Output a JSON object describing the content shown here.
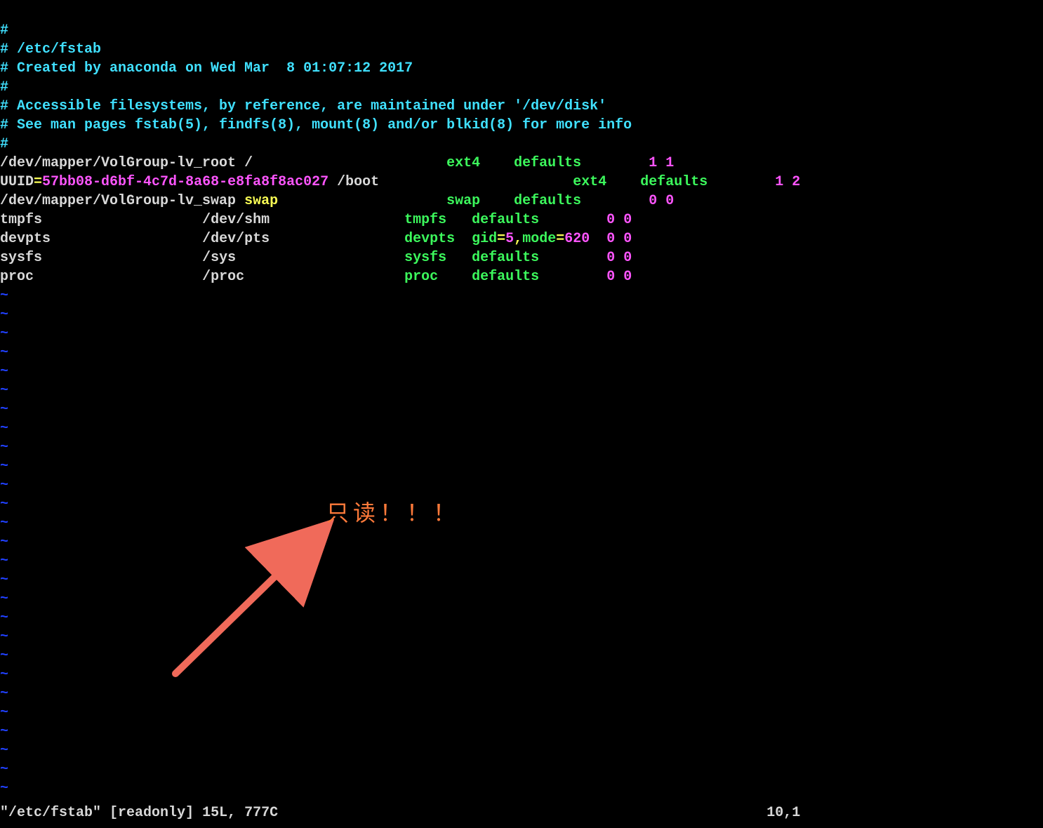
{
  "comments": {
    "l1": "#",
    "l2": "# /etc/fstab",
    "l3": "# Created by anaconda on Wed Mar  8 01:07:12 2017",
    "l4": "#",
    "l5": "# Accessible filesystems, by reference, are maintained under '/dev/disk'",
    "l6": "# See man pages fstab(5), findfs(8), mount(8) and/or blkid(8) for more info",
    "l7": "#"
  },
  "rows": {
    "root": {
      "device": "/dev/mapper/VolGroup-lv_root",
      "mount": "/",
      "type": "ext4",
      "opts": "defaults",
      "dump": "1",
      "pass": "1"
    },
    "boot": {
      "uuid_key": "UUID",
      "eq": "=",
      "uuid": "57bb08-d6bf-4c7d-8a68-e8fa8f8ac027",
      "mount": "/boot",
      "type": "ext4",
      "opts": "defaults",
      "dump": "1",
      "pass": "2"
    },
    "swap": {
      "device": "/dev/mapper/VolGroup-lv_swap",
      "mount": "swap",
      "type": "swap",
      "opts": "defaults",
      "dump": "0",
      "pass": "0"
    },
    "tmpfs": {
      "device": "tmpfs",
      "mount": "/dev/shm",
      "type": "tmpfs",
      "opts": "defaults",
      "dump": "0",
      "pass": "0"
    },
    "devpts": {
      "device": "devpts",
      "mount": "/dev/pts",
      "type": "devpts",
      "opt_gid_k": "gid",
      "opt_gid_eq": "=",
      "opt_gid_v": "5",
      "opt_sep": ",",
      "opt_mode_k": "mode",
      "opt_mode_eq": "=",
      "opt_mode_v": "620",
      "dump": "0",
      "pass": "0"
    },
    "sysfs": {
      "device": "sysfs",
      "mount": "/sys",
      "type": "sysfs",
      "opts": "defaults",
      "dump": "0",
      "pass": "0"
    },
    "proc": {
      "device": "proc",
      "mount": "/proc",
      "type": "proc",
      "opts": "defaults",
      "dump": "0",
      "pass": "0"
    }
  },
  "tilde": "~",
  "status": {
    "filename": "\"/etc/fstab\"",
    "flag": "[readonly]",
    "size": "15L, 777C",
    "pos": "10,1"
  },
  "annotation_text": "只读！！！"
}
